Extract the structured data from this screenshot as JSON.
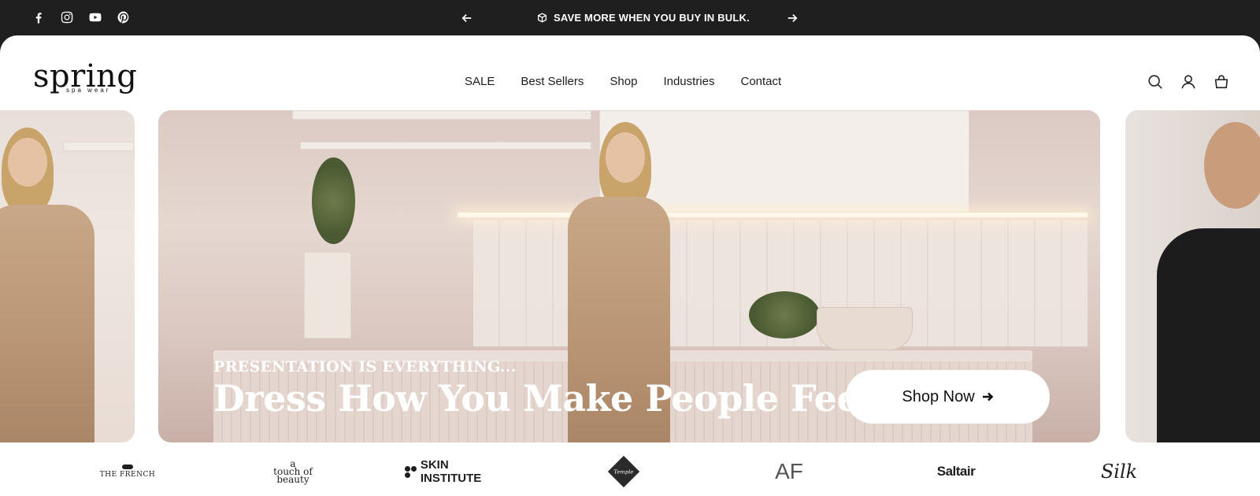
{
  "announcement": {
    "text": "SAVE MORE WHEN YOU BUY IN BULK.",
    "icon": "box-icon"
  },
  "socials": [
    "facebook-icon",
    "instagram-icon",
    "youtube-icon",
    "pinterest-icon"
  ],
  "logo": {
    "word": "spring",
    "sub": "spa wear"
  },
  "nav": {
    "items": [
      "SALE",
      "Best Sellers",
      "Shop",
      "Industries",
      "Contact"
    ]
  },
  "header_icons": [
    "search-icon",
    "account-icon",
    "cart-icon"
  ],
  "hero": {
    "eyebrow": "PRESENTATION IS EVERYTHING...",
    "title": "Dress How You Make People Feel",
    "cta": "Shop Now"
  },
  "brands": {
    "french": "THE FRENCH",
    "touch": [
      "a",
      "touch of",
      "beauty"
    ],
    "skin": "SKIN INSTITUTE",
    "temple": "Temple",
    "af": "AF",
    "saltair": "Saltair",
    "silk": "Silk"
  },
  "colors": {
    "topbar": "#1f1f1f",
    "text": "#1e1e1e",
    "hero_overlay_text": "#ffffff"
  }
}
